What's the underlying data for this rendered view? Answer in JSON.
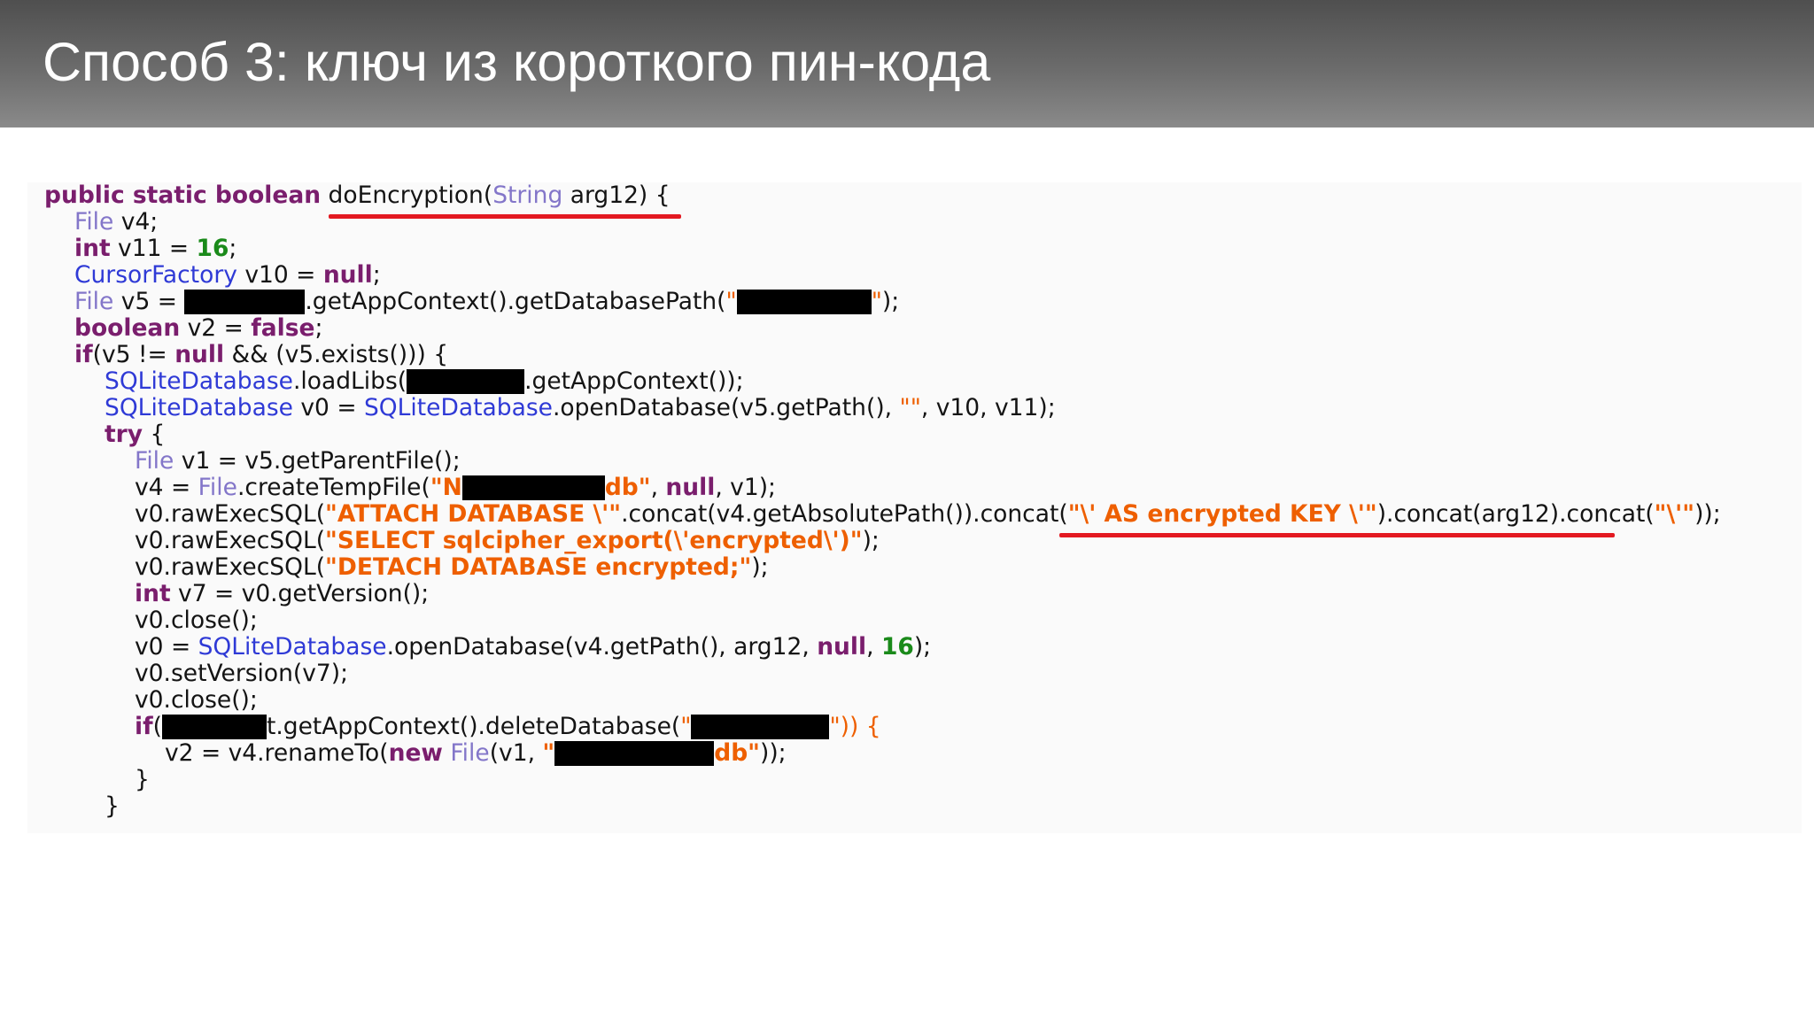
{
  "slide": {
    "title": "Способ 3: ключ из короткого пин-кода"
  },
  "code": {
    "l1": {
      "a": "public static boolean",
      "b": " ",
      "c": "doEncryption",
      "d": "(",
      "e": "String",
      "f": " arg12) {"
    },
    "l2": {
      "a": "File",
      "b": " v4;"
    },
    "l3": {
      "a": "int",
      "b": " v11 = ",
      "c": "16",
      "d": ";"
    },
    "l4": {
      "a": "CursorFactory",
      "b": " v10 = ",
      "c": "null",
      "d": ";"
    },
    "l5": {
      "a": "File",
      "b": " v5 = ",
      "c": ".getAppContext().getDatabasePath(",
      "d": "\"",
      "e": "\"",
      "f": ");"
    },
    "l6": {
      "a": "boolean",
      "b": " v2 = ",
      "c": "false",
      "d": ";"
    },
    "l7": {
      "a": "if",
      "b": "(v5 != ",
      "c": "null",
      "d": " && (v5.exists())) {"
    },
    "l8": {
      "a": "SQLiteDatabase",
      "b": ".loadLibs(",
      "c": ".getAppContext());"
    },
    "l9": {
      "a": "SQLiteDatabase",
      "b": " v0 = ",
      "c": "SQLiteDatabase",
      "d": ".openDatabase(v5.getPath(), ",
      "e": "\"\"",
      "f": ", v10, v11);"
    },
    "l10": {
      "a": "try",
      "b": " {"
    },
    "l11": {
      "a": "File",
      "b": " v1 = v5.getParentFile();"
    },
    "l12": {
      "a": "v4 = ",
      "b": "File",
      "c": ".createTempFile(",
      "d": "\"N",
      "e": "db\"",
      "f": ", ",
      "g": "null",
      "h": ", v1);"
    },
    "l13": {
      "a": "v0.rawExecSQL(",
      "b": "\"ATTACH DATABASE \\'\"",
      "c": ".concat(v4.getAbsolutePath()).concat(",
      "d": "\"\\' AS encrypted KEY \\'\"",
      "e": ").concat(arg12).concat(",
      "f": "\"\\'\"",
      "g": "));"
    },
    "l14": {
      "a": "v0.rawExecSQL(",
      "b": "\"SELECT sqlcipher_export(\\'encrypted\\')\"",
      "c": ");"
    },
    "l15": {
      "a": "v0.rawExecSQL(",
      "b": "\"DETACH DATABASE encrypted;\"",
      "c": ");"
    },
    "l16": {
      "a": "int",
      "b": " v7 = v0.getVersion();"
    },
    "l17": {
      "a": "v0.close();"
    },
    "l18": {
      "a": "v0 = ",
      "b": "SQLiteDatabase",
      "c": ".openDatabase(v4.getPath(), arg12, ",
      "d": "null",
      "e": ", ",
      "f": "16",
      "g": ");"
    },
    "l19": {
      "a": "v0.setVersion(v7);"
    },
    "l20": {
      "a": "v0.close();"
    },
    "l21": {
      "a": "if",
      "b": "(",
      "c": "t.getAppContext().deleteDatabase(",
      "d": "\"",
      "e": "\")) {"
    },
    "l22": {
      "a": "v2 = v4.renameTo(",
      "b": "new",
      "c": " ",
      "d": "File",
      "e": "(v1, ",
      "f": "\"",
      "g": "db\"",
      "h": "));"
    },
    "l23": {
      "a": "}"
    },
    "l24": {
      "a": "}"
    }
  },
  "colors": {
    "keyword": "#7a1e6d",
    "type": "#8376c9",
    "database_class": "#2f3ad6",
    "number": "#1a8a1a",
    "string": "#ee5f00",
    "highlight_underline": "#e31921",
    "redaction": "#000000"
  }
}
